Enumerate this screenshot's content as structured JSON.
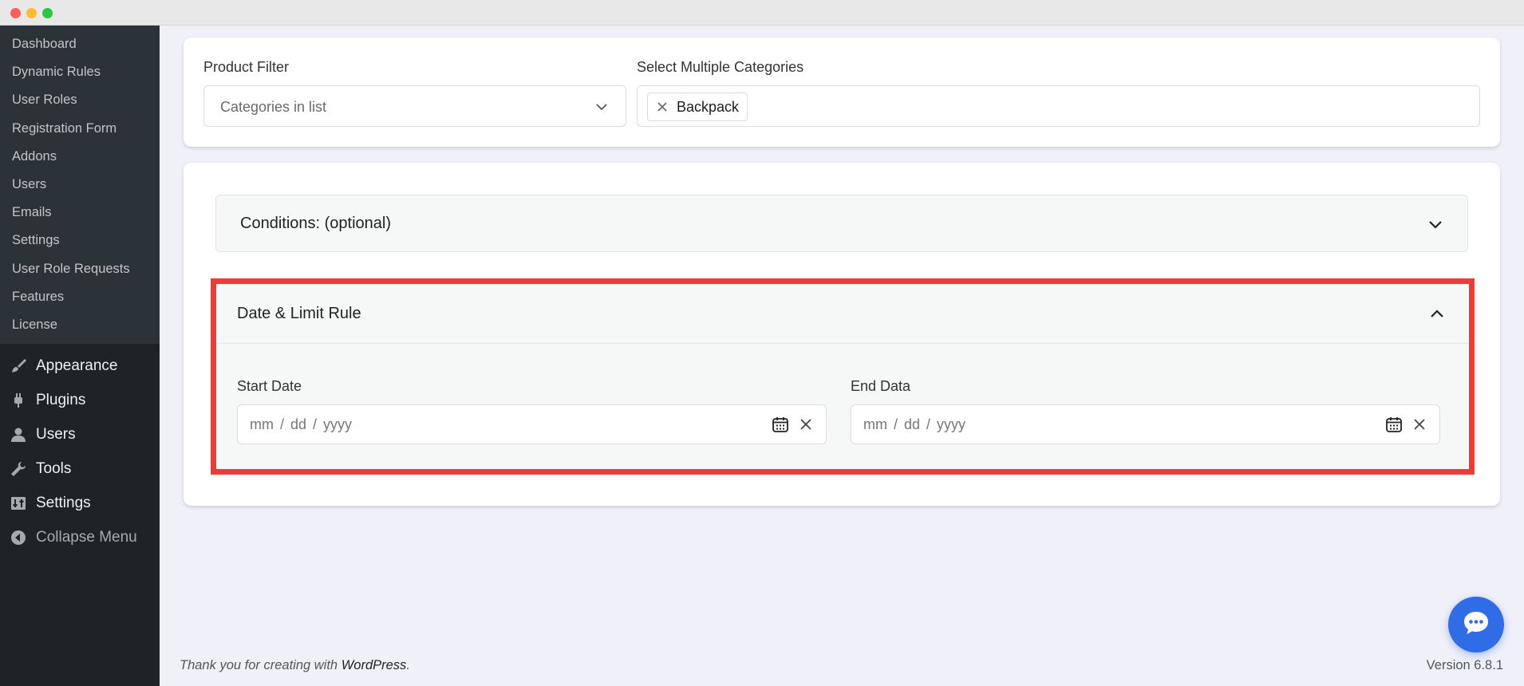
{
  "sidebar": {
    "submenu": [
      "Dashboard",
      "Dynamic Rules",
      "User Roles",
      "Registration Form",
      "Addons",
      "Users",
      "Emails",
      "Settings",
      "User Role Requests",
      "Features",
      "License"
    ],
    "menu": [
      {
        "label": "Appearance",
        "icon": "paintbrush-icon"
      },
      {
        "label": "Plugins",
        "icon": "plugin-icon"
      },
      {
        "label": "Users",
        "icon": "user-icon"
      },
      {
        "label": "Tools",
        "icon": "wrench-icon"
      },
      {
        "label": "Settings",
        "icon": "sliders-icon"
      },
      {
        "label": "Collapse Menu",
        "icon": "collapse-arrow-icon"
      }
    ]
  },
  "filter": {
    "product_filter_label": "Product Filter",
    "product_filter_value": "Categories in list",
    "categories_label": "Select Multiple Categories",
    "selected_categories": [
      "Backpack"
    ]
  },
  "conditions": {
    "title": "Conditions: (optional)"
  },
  "date_limit": {
    "title": "Date & Limit Rule",
    "start_label": "Start Date",
    "end_label": "End Data",
    "date_placeholder": "mm / dd / yyyy"
  },
  "footer": {
    "thanks_prefix": "Thank you for creating with",
    "wordpress_link": "WordPress",
    "thanks_suffix": ".",
    "version": "Version 6.8.1"
  },
  "colors": {
    "highlight_border": "#ef3b36",
    "sidebar_bg": "#1d2327",
    "chat_button": "#2f6ce5"
  }
}
